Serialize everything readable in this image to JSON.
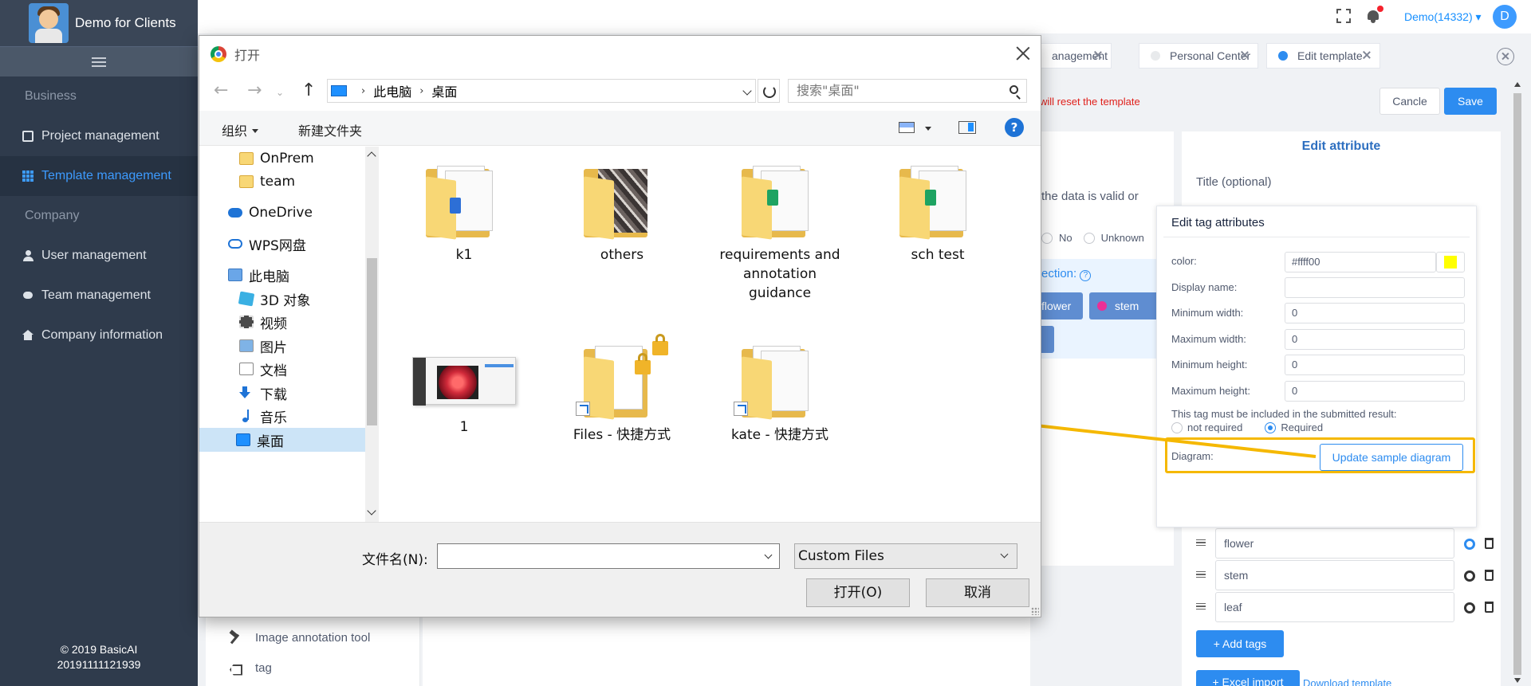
{
  "app": {
    "brand_name": "Demo for Clients",
    "copyright": "© 2019 BasicAI",
    "build": "20191111121939"
  },
  "sidebar": {
    "sections": [
      {
        "title": "Business",
        "items": [
          {
            "label": "Project management",
            "icon": "book-icon"
          },
          {
            "label": "Template management",
            "icon": "grid-icon",
            "active": true
          }
        ]
      },
      {
        "title": "Company",
        "items": [
          {
            "label": "User management",
            "icon": "user-icon"
          },
          {
            "label": "Team management",
            "icon": "team-icon"
          },
          {
            "label": "Company information",
            "icon": "home-icon"
          }
        ]
      }
    ]
  },
  "header": {
    "account": "Demo(14332) ▾",
    "avatar_letter": "D"
  },
  "tabs": [
    {
      "label": "anagement"
    },
    {
      "label": "Personal Center"
    },
    {
      "label": "Edit template",
      "active": true
    }
  ],
  "page": {
    "warning_text": "will reset the template",
    "cancel_label": "Cancle",
    "save_label": "Save",
    "mid_text_1": "the data is valid or",
    "radio_no": "No",
    "radio_unknown": "Unknown",
    "selection_label": "ection:",
    "chip_flower": "flower",
    "chip_stem": "stem",
    "chip_partial": "f",
    "tools": [
      {
        "label": "Image annotation tool",
        "icon": "hammer-icon"
      },
      {
        "label": "tag",
        "icon": "tag-icon"
      }
    ]
  },
  "edit_attribute": {
    "title": "Edit attribute",
    "subtitle": "Title (optional)",
    "tags": [
      {
        "value": "flower"
      },
      {
        "value": "stem"
      },
      {
        "value": "leaf"
      }
    ],
    "add_tags_label": "+ Add tags",
    "excel_import_label": "+ Excel import",
    "download_template_label": "Download template"
  },
  "tag_popover": {
    "title": "Edit tag attributes",
    "color_label": "color:",
    "color_value": "#ffff00",
    "swatch_color": "#ffff00",
    "display_name_label": "Display name:",
    "display_name_value": "",
    "min_width_label": "Minimum width:",
    "min_width_value": "0",
    "max_width_label": "Maximum width:",
    "max_width_value": "0",
    "min_height_label": "Minimum height:",
    "min_height_value": "0",
    "max_height_label": "Maximum height:",
    "max_height_value": "0",
    "required_question": "This tag must be included in the submitted result:",
    "not_required_label": "not required",
    "required_label": "Required",
    "diagram_label": "Diagram:",
    "update_diagram_label": "Update sample diagram"
  },
  "annotation": {
    "highlight_color": "#f5b800"
  },
  "file_dialog": {
    "title": "打开",
    "breadcrumb": [
      "此电脑",
      "桌面"
    ],
    "search_placeholder": "搜索\"桌面\"",
    "organize_label": "组织",
    "new_folder_label": "新建文件夹",
    "help_label": "?",
    "nav_items": [
      {
        "label": "OnPrem",
        "icon": "folder-icon"
      },
      {
        "label": "team",
        "icon": "folder-icon"
      },
      {
        "label": "OneDrive",
        "icon": "onedrive-icon"
      },
      {
        "label": "WPS网盘",
        "icon": "wps-cloud-icon"
      },
      {
        "label": "此电脑",
        "icon": "this-pc-icon"
      },
      {
        "label": "3D 对象",
        "icon": "3d-objects-icon"
      },
      {
        "label": "视频",
        "icon": "videos-icon"
      },
      {
        "label": "图片",
        "icon": "pictures-icon"
      },
      {
        "label": "文档",
        "icon": "documents-icon"
      },
      {
        "label": "下载",
        "icon": "downloads-icon"
      },
      {
        "label": "音乐",
        "icon": "music-icon"
      },
      {
        "label": "桌面",
        "icon": "desktop-icon",
        "selected": true
      }
    ],
    "files": [
      {
        "name": "k1",
        "kind": "folder"
      },
      {
        "name": "others",
        "kind": "folder"
      },
      {
        "name": "requirements and annotation guidance",
        "kind": "folder"
      },
      {
        "name": "sch test",
        "kind": "folder"
      },
      {
        "name": "1",
        "kind": "image"
      },
      {
        "name": "Files - 快捷方式",
        "kind": "shortcut"
      },
      {
        "name": "kate - 快捷方式",
        "kind": "shortcut"
      }
    ],
    "filename_label": "文件名(N):",
    "filename_value": "",
    "filetype_value": "Custom Files",
    "open_label": "打开(O)",
    "cancel_label": "取消"
  }
}
